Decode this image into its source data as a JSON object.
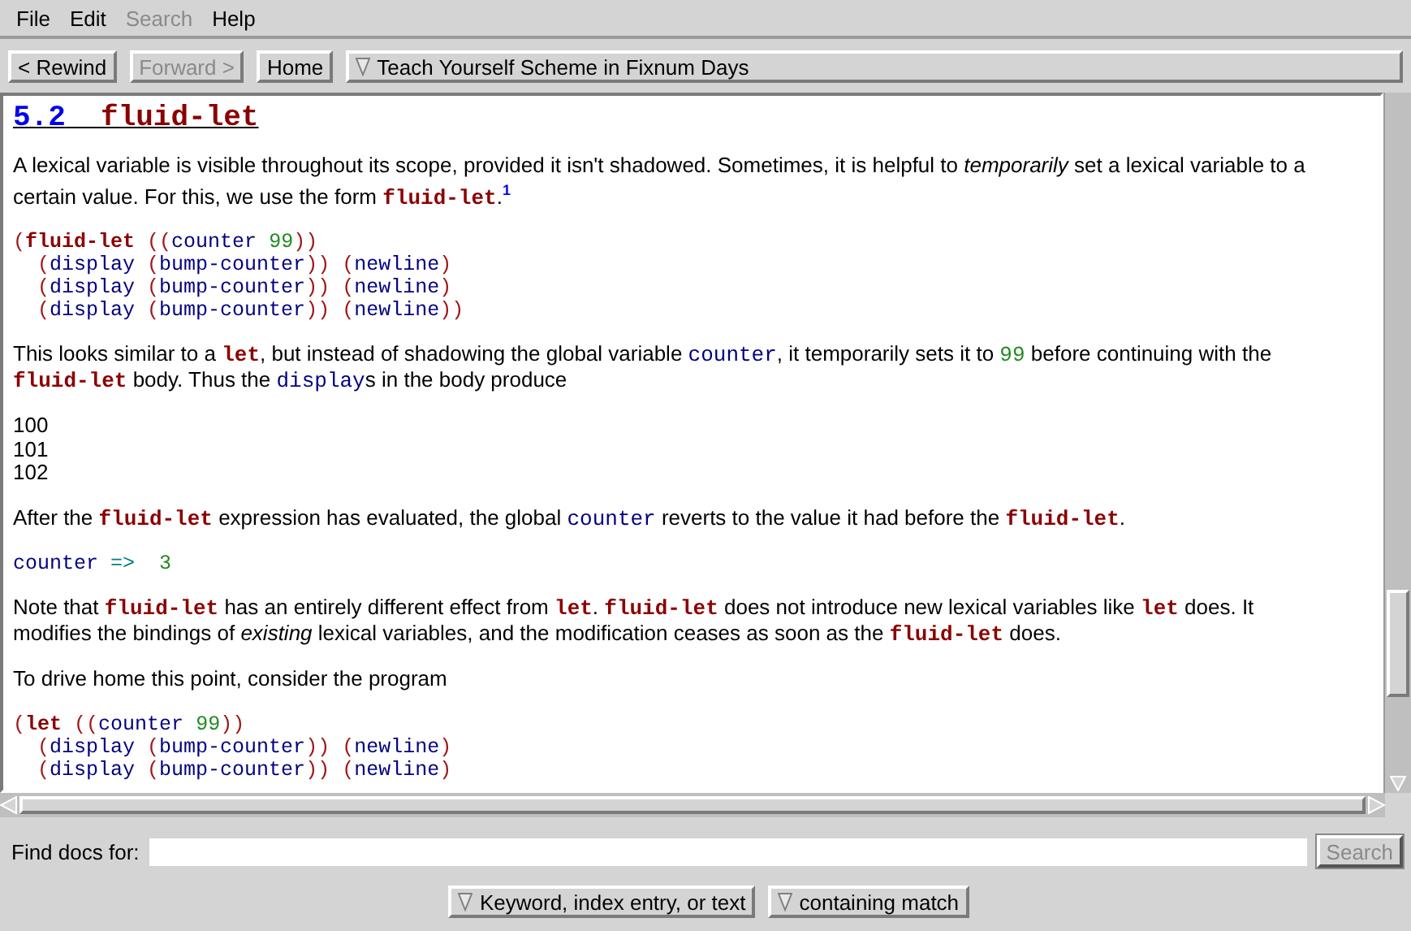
{
  "menu": [
    {
      "label": "File",
      "disabled": false
    },
    {
      "label": "Edit",
      "disabled": false
    },
    {
      "label": "Search",
      "disabled": true
    },
    {
      "label": "Help",
      "disabled": false
    }
  ],
  "toolbar": [
    {
      "kind": "button",
      "label": "< Rewind",
      "disabled": false
    },
    {
      "kind": "button",
      "label": "Forward >",
      "disabled": true
    },
    {
      "kind": "button",
      "label": "Home",
      "disabled": false
    },
    {
      "kind": "dropdown",
      "label": "Teach Yourself Scheme in Fixnum Days",
      "disabled": false
    }
  ],
  "document": {
    "heading": {
      "number": "5.2",
      "title": "fluid-let"
    },
    "blocks": [
      {
        "kind": "para",
        "runs": [
          {
            "kind": "plain",
            "text": "A lexical variable is visible throughout its scope, provided it isn't shadowed. Sometimes, it is helpful to "
          },
          {
            "kind": "em",
            "text": "temporarily"
          },
          {
            "kind": "plain",
            "text": " set a lexical variable to a certain value. For this, we use the form "
          },
          {
            "kind": "kw",
            "text": "fluid-let"
          },
          {
            "kind": "plain",
            "text": "."
          },
          {
            "kind": "fn",
            "text": "1"
          }
        ]
      },
      {
        "kind": "code",
        "lines": [
          [
            {
              "kind": "p",
              "text": "("
            },
            {
              "kind": "kw",
              "text": "fluid-let"
            },
            {
              "kind": "p",
              "text": " (("
            },
            {
              "kind": "id",
              "text": "counter"
            },
            {
              "kind": "num",
              "text": " 99"
            },
            {
              "kind": "p",
              "text": "))"
            }
          ],
          [
            {
              "kind": "p",
              "text": "  ("
            },
            {
              "kind": "id",
              "text": "display"
            },
            {
              "kind": "p",
              "text": " ("
            },
            {
              "kind": "id",
              "text": "bump-counter"
            },
            {
              "kind": "p",
              "text": ")) ("
            },
            {
              "kind": "id",
              "text": "newline"
            },
            {
              "kind": "p",
              "text": ")"
            }
          ],
          [
            {
              "kind": "p",
              "text": "  ("
            },
            {
              "kind": "id",
              "text": "display"
            },
            {
              "kind": "p",
              "text": " ("
            },
            {
              "kind": "id",
              "text": "bump-counter"
            },
            {
              "kind": "p",
              "text": ")) ("
            },
            {
              "kind": "id",
              "text": "newline"
            },
            {
              "kind": "p",
              "text": ")"
            }
          ],
          [
            {
              "kind": "p",
              "text": "  ("
            },
            {
              "kind": "id",
              "text": "display"
            },
            {
              "kind": "p",
              "text": " ("
            },
            {
              "kind": "id",
              "text": "bump-counter"
            },
            {
              "kind": "p",
              "text": ")) ("
            },
            {
              "kind": "id",
              "text": "newline"
            },
            {
              "kind": "p",
              "text": "))"
            }
          ]
        ]
      },
      {
        "kind": "para",
        "runs": [
          {
            "kind": "plain",
            "text": "This looks similar to a "
          },
          {
            "kind": "kw",
            "text": "let"
          },
          {
            "kind": "plain",
            "text": ", but instead of shadowing the global variable "
          },
          {
            "kind": "id",
            "text": "counter"
          },
          {
            "kind": "plain",
            "text": ", it temporarily sets it to "
          },
          {
            "kind": "num",
            "text": "99"
          },
          {
            "kind": "plain",
            "text": " before continuing with the "
          },
          {
            "kind": "kw",
            "text": "fluid-let"
          },
          {
            "kind": "plain",
            "text": " body. Thus the "
          },
          {
            "kind": "id",
            "text": "display"
          },
          {
            "kind": "plain",
            "text": "s in the body produce"
          }
        ]
      },
      {
        "kind": "output",
        "lines": [
          "100",
          "101",
          "102"
        ]
      },
      {
        "kind": "para",
        "runs": [
          {
            "kind": "plain",
            "text": "After the "
          },
          {
            "kind": "kw",
            "text": "fluid-let"
          },
          {
            "kind": "plain",
            "text": " expression has evaluated, the global "
          },
          {
            "kind": "id",
            "text": "counter"
          },
          {
            "kind": "plain",
            "text": " reverts to the value it had before the "
          },
          {
            "kind": "kw",
            "text": "fluid-let"
          },
          {
            "kind": "plain",
            "text": "."
          }
        ]
      },
      {
        "kind": "code",
        "lines": [
          [
            {
              "kind": "id",
              "text": "counter"
            },
            {
              "kind": "arrow",
              "text": " =>  "
            },
            {
              "kind": "num",
              "text": "3"
            }
          ]
        ]
      },
      {
        "kind": "para",
        "runs": [
          {
            "kind": "plain",
            "text": "Note that "
          },
          {
            "kind": "kw",
            "text": "fluid-let"
          },
          {
            "kind": "plain",
            "text": " has an entirely different effect from "
          },
          {
            "kind": "kw",
            "text": "let"
          },
          {
            "kind": "plain",
            "text": ". "
          },
          {
            "kind": "kw",
            "text": "fluid-let"
          },
          {
            "kind": "plain",
            "text": " does not introduce new lexical variables like "
          },
          {
            "kind": "kw",
            "text": "let"
          },
          {
            "kind": "plain",
            "text": " does. It modifies the bindings of "
          },
          {
            "kind": "em",
            "text": "existing"
          },
          {
            "kind": "plain",
            "text": " lexical variables, and the modification ceases as soon as the "
          },
          {
            "kind": "kw",
            "text": "fluid-let"
          },
          {
            "kind": "plain",
            "text": " does."
          }
        ]
      },
      {
        "kind": "para",
        "runs": [
          {
            "kind": "plain",
            "text": "To drive home this point, consider the program"
          }
        ]
      },
      {
        "kind": "code",
        "lines": [
          [
            {
              "kind": "p",
              "text": "("
            },
            {
              "kind": "kw",
              "text": "let"
            },
            {
              "kind": "p",
              "text": " (("
            },
            {
              "kind": "id",
              "text": "counter"
            },
            {
              "kind": "num",
              "text": " 99"
            },
            {
              "kind": "p",
              "text": "))"
            }
          ],
          [
            {
              "kind": "p",
              "text": "  ("
            },
            {
              "kind": "id",
              "text": "display"
            },
            {
              "kind": "p",
              "text": " ("
            },
            {
              "kind": "id",
              "text": "bump-counter"
            },
            {
              "kind": "p",
              "text": ")) ("
            },
            {
              "kind": "id",
              "text": "newline"
            },
            {
              "kind": "p",
              "text": ")"
            }
          ],
          [
            {
              "kind": "p",
              "text": "  ("
            },
            {
              "kind": "id",
              "text": "display"
            },
            {
              "kind": "p",
              "text": " ("
            },
            {
              "kind": "id",
              "text": "bump-counter"
            },
            {
              "kind": "p",
              "text": ")) ("
            },
            {
              "kind": "id",
              "text": "newline"
            },
            {
              "kind": "p",
              "text": ")"
            }
          ]
        ]
      }
    ]
  },
  "find": {
    "label": "Find docs for:",
    "search_button": {
      "label": "Search",
      "disabled": true
    }
  },
  "options": [
    {
      "label": "Keyword, index entry, or text"
    },
    {
      "label": "containing match"
    }
  ]
}
